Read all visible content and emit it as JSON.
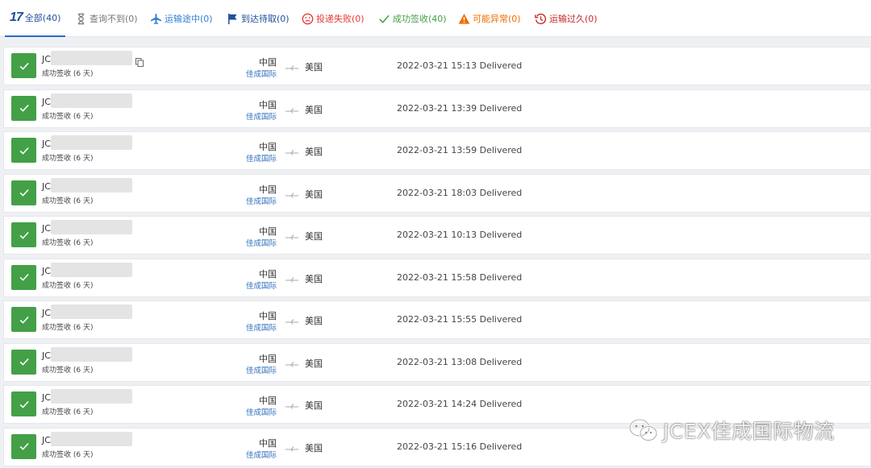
{
  "tabs": [
    {
      "label": "全部(40)",
      "icon": "logo-17-icon",
      "color": "#1f4e9c",
      "active": true
    },
    {
      "label": "查询不到(0)",
      "icon": "hourglass-icon",
      "color": "#777777"
    },
    {
      "label": "运输途中(0)",
      "icon": "airplane-icon",
      "color": "#2f7fd3"
    },
    {
      "label": "到达待取(0)",
      "icon": "flag-icon",
      "color": "#1f4e9c"
    },
    {
      "label": "投递失败(0)",
      "icon": "sad-face-icon",
      "color": "#e53935"
    },
    {
      "label": "成功签收(40)",
      "icon": "checkmark-icon",
      "color": "#43a047"
    },
    {
      "label": "可能异常(0)",
      "icon": "warning-icon",
      "color": "#ef6c00"
    },
    {
      "label": "运输过久(0)",
      "icon": "clock-history-icon",
      "color": "#c62828"
    }
  ],
  "logo_text": "17",
  "shipments": [
    {
      "tracking": "JC",
      "status": "成功签收 (6 天)",
      "origin": "中国",
      "carrier": "佳成国际",
      "destination": "美国",
      "time": "2022-03-21 15:13",
      "event": "Delivered"
    },
    {
      "tracking": "JC",
      "status": "成功签收 (6 天)",
      "origin": "中国",
      "carrier": "佳成国际",
      "destination": "美国",
      "time": "2022-03-21 13:39",
      "event": "Delivered"
    },
    {
      "tracking": "JC",
      "status": "成功签收 (6 天)",
      "origin": "中国",
      "carrier": "佳成国际",
      "destination": "美国",
      "time": "2022-03-21 13:59",
      "event": "Delivered"
    },
    {
      "tracking": "JC",
      "status": "成功签收 (6 天)",
      "origin": "中国",
      "carrier": "佳成国际",
      "destination": "美国",
      "time": "2022-03-21 18:03",
      "event": "Delivered"
    },
    {
      "tracking": "JC",
      "status": "成功签收 (6 天)",
      "origin": "中国",
      "carrier": "佳成国际",
      "destination": "美国",
      "time": "2022-03-21 10:13",
      "event": "Delivered"
    },
    {
      "tracking": "JC",
      "status": "成功签收 (6 天)",
      "origin": "中国",
      "carrier": "佳成国际",
      "destination": "美国",
      "time": "2022-03-21 15:58",
      "event": "Delivered"
    },
    {
      "tracking": "JC",
      "status": "成功签收 (6 天)",
      "origin": "中国",
      "carrier": "佳成国际",
      "destination": "美国",
      "time": "2022-03-21 15:55",
      "event": "Delivered"
    },
    {
      "tracking": "JC",
      "status": "成功签收 (6 天)",
      "origin": "中国",
      "carrier": "佳成国际",
      "destination": "美国",
      "time": "2022-03-21 13:08",
      "event": "Delivered"
    },
    {
      "tracking": "JC",
      "status": "成功签收 (6 天)",
      "origin": "中国",
      "carrier": "佳成国际",
      "destination": "美国",
      "time": "2022-03-21 14:24",
      "event": "Delivered"
    },
    {
      "tracking": "JC",
      "status": "成功签收 (6 天)",
      "origin": "中国",
      "carrier": "佳成国际",
      "destination": "美国",
      "time": "2022-03-21 15:16",
      "event": "Delivered"
    }
  ],
  "watermark": {
    "text": "JCEX佳成国际物流",
    "icon": "wechat-icon"
  },
  "colors": {
    "delivered": "#43a047",
    "carrier_link": "#2f6fbd",
    "active_tab": "#2b6cc4"
  }
}
